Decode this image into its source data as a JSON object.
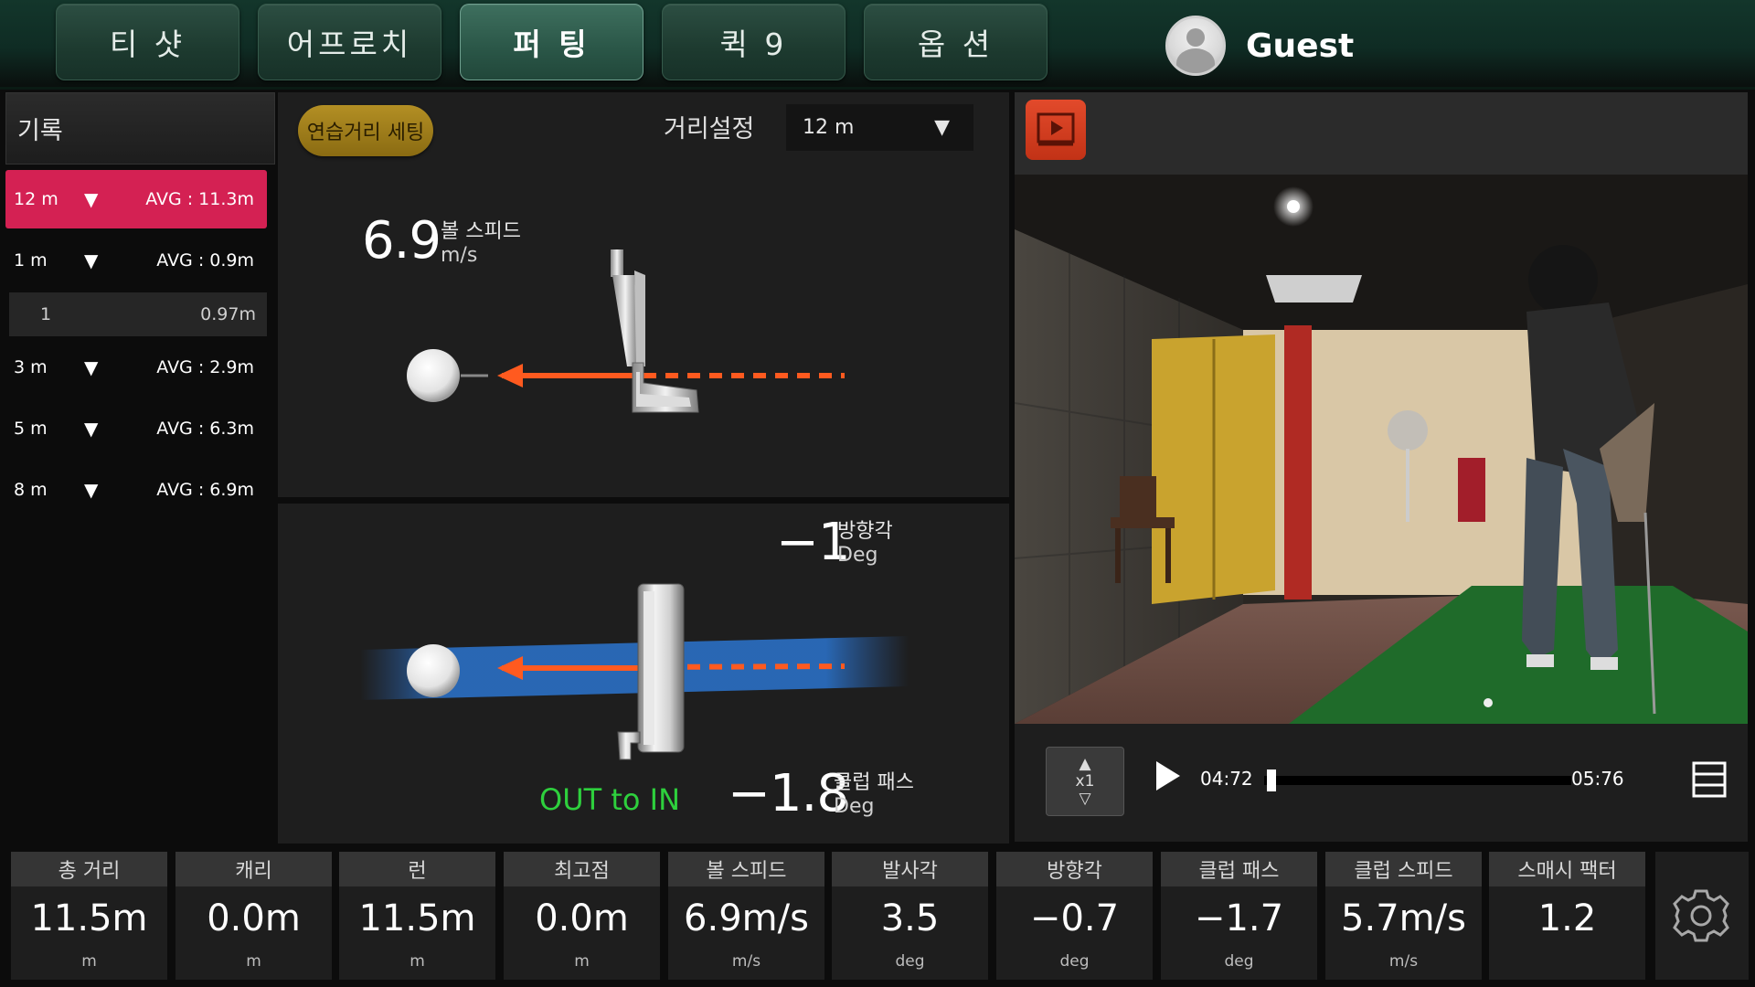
{
  "tabs": [
    {
      "label": "티 샷"
    },
    {
      "label": "어프로치"
    },
    {
      "label": "퍼 팅",
      "active": true
    },
    {
      "label": "퀵 9"
    },
    {
      "label": "옵 션"
    }
  ],
  "user": {
    "name": "Guest"
  },
  "records": {
    "header": "기록",
    "rows": [
      {
        "dist": "12 m",
        "avg": "AVG : 11.3m"
      },
      {
        "dist": "1 m",
        "avg": "AVG : 0.9m"
      },
      {
        "dist": "3 m",
        "avg": "AVG : 2.9m"
      },
      {
        "dist": "5 m",
        "avg": "AVG : 6.3m"
      },
      {
        "dist": "8 m",
        "avg": "AVG : 6.9m"
      }
    ],
    "sub": {
      "index": "1",
      "value": "0.97m"
    }
  },
  "setting": {
    "practice_button": "연습거리 세팅",
    "distance_label": "거리설정",
    "distance_value": "12 m"
  },
  "ball_speed": {
    "value": "6.9",
    "label": "볼 스피드",
    "unit": "m/s"
  },
  "direction": {
    "value": "−1",
    "label": "방향각",
    "unit": "Deg"
  },
  "club_path": {
    "value": "−1.8",
    "label": "클럽 패스",
    "unit": "Deg",
    "path_text": "OUT to IN"
  },
  "video": {
    "speed": "x1",
    "time_current": "04:72",
    "time_total": "05:76",
    "progress": 0.01
  },
  "stats": [
    {
      "label": "총 거리",
      "value": "11.5m",
      "unit": "m"
    },
    {
      "label": "캐리",
      "value": "0.0m",
      "unit": "m"
    },
    {
      "label": "런",
      "value": "11.5m",
      "unit": "m"
    },
    {
      "label": "최고점",
      "value": "0.0m",
      "unit": "m"
    },
    {
      "label": "볼 스피드",
      "value": "6.9m/s",
      "unit": "m/s"
    },
    {
      "label": "발사각",
      "value": "3.5",
      "unit": "deg"
    },
    {
      "label": "방향각",
      "value": "−0.7",
      "unit": "deg"
    },
    {
      "label": "클럽 패스",
      "value": "−1.7",
      "unit": "deg"
    },
    {
      "label": "클럽 스피드",
      "value": "5.7m/s",
      "unit": "m/s"
    },
    {
      "label": "스매시 팩터",
      "value": "1.2",
      "unit": ""
    }
  ],
  "colors": {
    "accent_red": "#d42153",
    "arrow_orange": "#ff5a1f",
    "path_green": "#2ed03d",
    "tab_active": "#2a5647"
  }
}
